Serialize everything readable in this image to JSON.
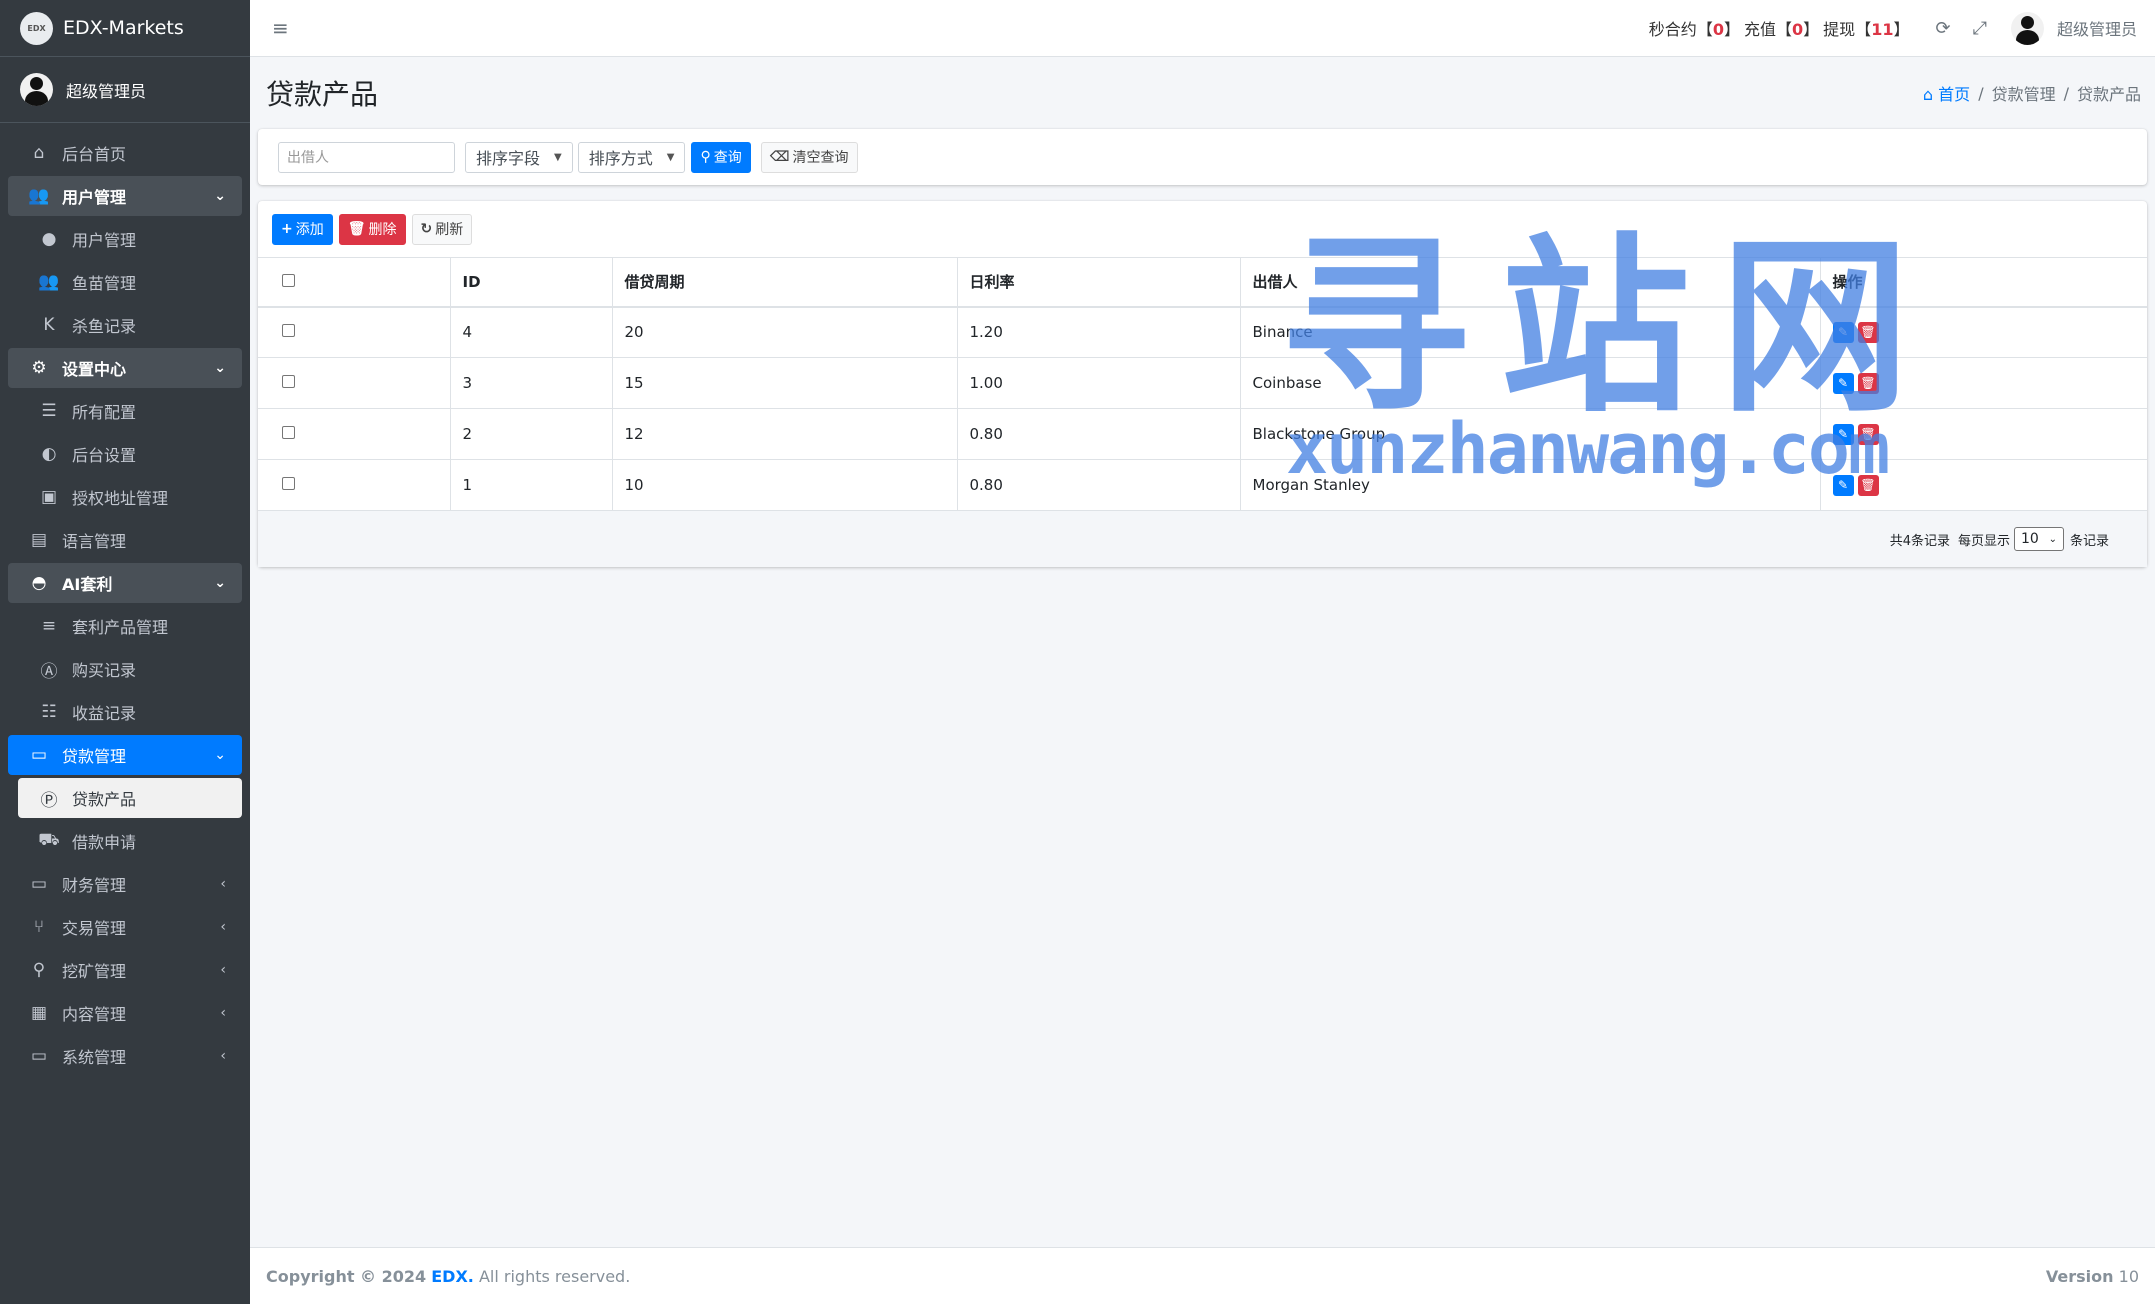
{
  "app": {
    "brand": "EDX-Markets",
    "logo_text": "EDX"
  },
  "user": {
    "name": "超级管理员"
  },
  "sidebar": {
    "items": [
      {
        "label": "后台首页"
      },
      {
        "label": "用户管理"
      },
      {
        "label": "用户管理"
      },
      {
        "label": "鱼苗管理"
      },
      {
        "label": "杀鱼记录"
      },
      {
        "label": "设置中心"
      },
      {
        "label": "所有配置"
      },
      {
        "label": "后台设置"
      },
      {
        "label": "授权地址管理"
      },
      {
        "label": "语言管理"
      },
      {
        "label": "AI套利"
      },
      {
        "label": "套利产品管理"
      },
      {
        "label": "购买记录"
      },
      {
        "label": "收益记录"
      },
      {
        "label": "贷款管理"
      },
      {
        "label": "贷款产品"
      },
      {
        "label": "借款申请"
      },
      {
        "label": "财务管理"
      },
      {
        "label": "交易管理"
      },
      {
        "label": "挖矿管理"
      },
      {
        "label": "内容管理"
      },
      {
        "label": "系统管理"
      }
    ]
  },
  "topbar": {
    "counters": [
      {
        "label": "秒合约",
        "open": "【",
        "value": "0",
        "close": "】"
      },
      {
        "label": "充值",
        "open": "【",
        "value": "0",
        "close": "】"
      },
      {
        "label": "提现",
        "open": "【",
        "value": "11",
        "close": "】"
      }
    ],
    "user_name": "超级管理员"
  },
  "page": {
    "title": "贷款产品",
    "breadcrumb": [
      "首页",
      "贷款管理",
      "贷款产品"
    ]
  },
  "search": {
    "placeholder": "出借人",
    "sort_field": "排序字段",
    "sort_order": "排序方式",
    "query_label": "查询",
    "clear_label": "清空查询"
  },
  "toolbar": {
    "add_label": "添加",
    "delete_label": "删除",
    "refresh_label": "刷新"
  },
  "table": {
    "headers": [
      "ID",
      "借贷周期",
      "日利率",
      "出借人",
      "操作"
    ],
    "rows": [
      {
        "id": "4",
        "period": "20",
        "rate": "1.20",
        "lender": "Binance"
      },
      {
        "id": "3",
        "period": "15",
        "rate": "1.00",
        "lender": "Coinbase"
      },
      {
        "id": "2",
        "period": "12",
        "rate": "0.80",
        "lender": "Blackstone Group"
      },
      {
        "id": "1",
        "period": "10",
        "rate": "0.80",
        "lender": "Morgan Stanley"
      }
    ]
  },
  "pager": {
    "total_text": "共4条记录",
    "per_page_prefix": "每页显示",
    "per_page": "10",
    "per_page_suffix": "条记录"
  },
  "watermark": {
    "line1": "寻站网",
    "line2": "xunzhanwang.com"
  },
  "footer": {
    "copyright": "Copyright © 2024",
    "brand": "EDX.",
    "rights": "All rights reserved.",
    "version_label": "Version",
    "version": "10"
  },
  "colors": {
    "primary": "#007bff",
    "danger": "#dc3545",
    "sidebar": "#343a40"
  }
}
